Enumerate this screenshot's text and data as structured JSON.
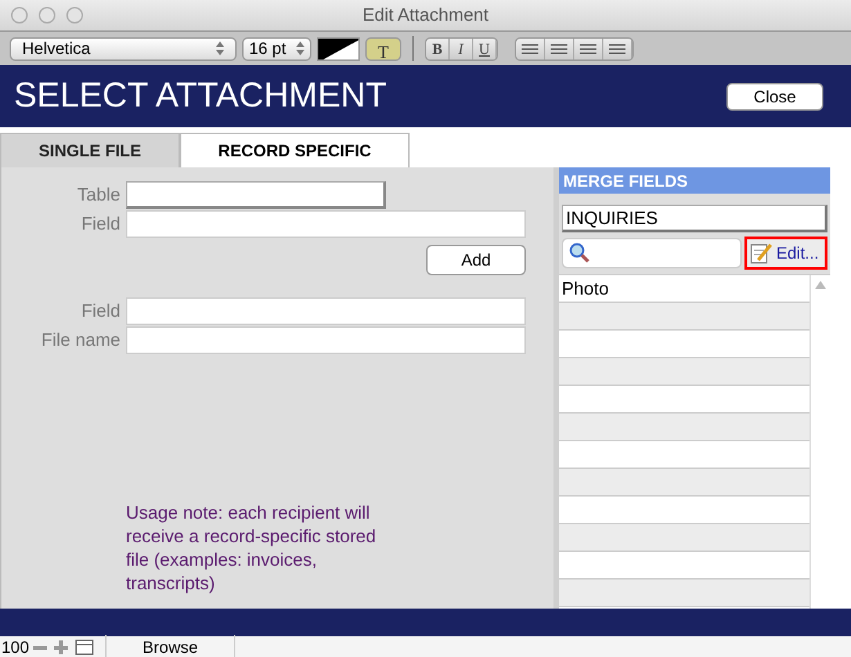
{
  "window": {
    "title": "Edit Attachment"
  },
  "toolbar": {
    "font": "Helvetica",
    "size": "16 pt",
    "text_color_button": "T",
    "style_buttons": [
      "B",
      "I",
      "U"
    ]
  },
  "header": {
    "title": "SELECT ATTACHMENT",
    "close_button": "Close"
  },
  "tabs": [
    {
      "label": "SINGLE FILE",
      "selected": false
    },
    {
      "label": "RECORD SPECIFIC",
      "selected": true
    }
  ],
  "form": {
    "top_fields": [
      {
        "label": "Table",
        "kind": "popup"
      },
      {
        "label": "Field",
        "kind": "text"
      }
    ],
    "add_button": "Add",
    "bottom_fields": [
      {
        "label": "Field",
        "kind": "text"
      },
      {
        "label": "File name",
        "kind": "text"
      }
    ],
    "note": "Usage note: each recipient will receive a record-specific stored file (examples: invoices, transcripts)"
  },
  "merge_fields": {
    "title": "MERGE FIELDS",
    "table": "INQUIRIES",
    "edit_button": "Edit...",
    "rows": [
      {
        "text": "Photo"
      }
    ]
  },
  "status_bar": {
    "zoom": "100",
    "mode": "Browse"
  }
}
